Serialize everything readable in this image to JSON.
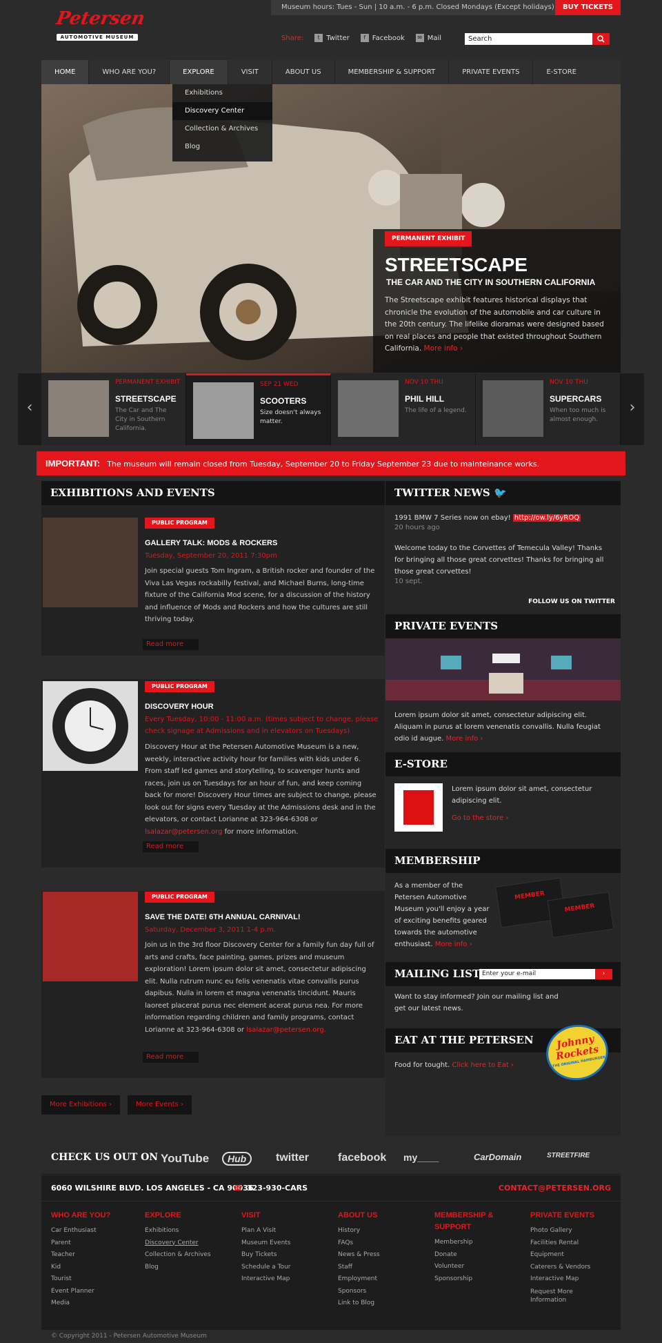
{
  "topbar": {
    "hours": "Museum hours: Tues - Sun | 10 a.m. - 6 p.m. Closed Mondays (Except holidays)",
    "buy": "BUY TICKETS"
  },
  "logo": {
    "name": "Petersen",
    "sub": "AUTOMOTIVE MUSEUM"
  },
  "share": {
    "label": "Share:",
    "twitter": "Twitter",
    "facebook": "Facebook",
    "mail": "Mail"
  },
  "search": {
    "placeholder": "Search"
  },
  "nav": [
    "HOME",
    "WHO ARE YOU?",
    "EXPLORE",
    "VISIT",
    "ABOUT US",
    "MEMBERSHIP & SUPPORT",
    "PRIVATE EVENTS",
    "E-STORE"
  ],
  "dropdown": [
    "Exhibitions",
    "Discovery Center",
    "Collection & Archives",
    "Blog"
  ],
  "hero": {
    "tag": "PERMANENT EXHIBIT",
    "title": "STREETSCAPE",
    "subtitle": "THE CAR AND THE CITY IN SOUTHERN CALIFORNIA",
    "body": "The Streetscape exhibit features historical displays that chronicle the evolution of the automobile and car culture in the 20th century. The lifelike dioramas were designed based on real places and people that existed throughout Southern California.",
    "more": "More info ›"
  },
  "slides": [
    {
      "date": "PERMANENT EXHIBIT",
      "title": "STREETSCAPE",
      "desc": "The Car and The City in Southern California."
    },
    {
      "date": "SEP 21 WED",
      "title": "SCOOTERS",
      "desc": "Size doesn't always matter."
    },
    {
      "date": "NOV 10 THU",
      "title": "PHIL HILL",
      "desc": "The life of a legend."
    },
    {
      "date": "NOV 10 THU",
      "title": "SUPERCARS",
      "desc": "When too much is almost enough."
    }
  ],
  "important": {
    "label": "IMPORTANT:",
    "text": "The museum will remain closed from Tuesday, September 20 to Friday September 23 due to mainteinance works."
  },
  "exhibitions": {
    "heading": "EXHIBITIONS AND EVENTS",
    "events": [
      {
        "tag": "PUBLIC PROGRAM",
        "title": "GALLERY TALK: MODS & ROCKERS",
        "date": "Tuesday, September 20, 2011 7:30pm",
        "body": "Join special guests Tom Ingram, a British rocker and founder of the Viva Las Vegas rockabilly festival, and Michael Burns, long-time fixture of the California Mod scene, for a discussion of the history and influence of Mods and Rockers and how the cultures are still thriving today.",
        "more": "Read more"
      },
      {
        "tag": "PUBLIC PROGRAM",
        "title": "DISCOVERY HOUR",
        "date": "Every Tuesday, 10:00 - 11:00 a.m. (times subject to change, please check signage at Admissions and in elevators on Tuesdays)",
        "body": "Discovery Hour at the Petersen Automotive Museum is a new, weekly, interactive activity hour for families with kids under 6. From staff led games and storytelling, to scavenger hunts and races, join us on Tuesdays for an hour of fun, and keep coming back for more! Discovery Hour times are subject to change, please look out for signs every Tuesday at the Admissions desk and in the elevators, or contact Lorianne at 323-964-6308 or",
        "email": "lsalazar@petersen.org",
        "tail": " for more information.",
        "more": "Read more"
      },
      {
        "tag": "PUBLIC PROGRAM",
        "title": "SAVE THE DATE! 6TH ANNUAL CARNIVAL!",
        "date": "Saturday, December 3, 2011 1-4 p.m.",
        "body": "Join us in the 3rd floor Discovery Center for a family fun day full of arts and crafts, face painting, games, prizes and museum exploration! Lorem ipsum dolor sit amet, consectetur adipiscing elit. Nulla rutrum nunc eu felis venenatis vitae convallis purus dapibus. Nulla in lorem et magna venenatis tincidunt. Mauris laoreet placerat purus nec element acerat purus nea. For more information regarding children and family programs, contact Lorianne at 323-964-6308 or",
        "email": "lsalazar@petersen.org.",
        "more": "Read more"
      }
    ],
    "more_exhibitions": "More Exhibitions ›",
    "more_events": "More Events ›"
  },
  "twitter": {
    "heading": "TWITTER NEWS",
    "t1": "1991 BMW 7 Series now on ebay!",
    "t1link": "http://ow.ly/6yROQ",
    "t1time": "20 hours ago",
    "t2": "Welcome today to the Corvettes of Temecula Valley! Thanks for bringing all those great corvettes! Thanks for bringing all those great corvettes!",
    "t2time": "10 sept.",
    "follow": "FOLLOW US ON TWITTER"
  },
  "private": {
    "heading": "PRIVATE EVENTS",
    "body": "Lorem ipsum dolor sit amet, consectetur adipiscing elit. Aliquam in purus at lorem venenatis convallis. Nulla feugiat odio id augue.",
    "more": "More info ›"
  },
  "estore": {
    "heading": "E-STORE",
    "body": "Lorem ipsum dolor sit amet, consectetur adipiscing elit.",
    "more": "Go to the store ›"
  },
  "membership": {
    "heading": "MEMBERSHIP",
    "body": "As a member of the Petersen Automotive Museum you'll enjoy a year of exciting benefits geared towards the automotive enthusiast.",
    "more": "More info ›",
    "card": "MEMBER"
  },
  "mailing": {
    "heading": "MAILING LIST",
    "placeholder": "Enter your e-mail",
    "body": "Want to stay informed? Join our mailing list and get our latest news."
  },
  "eat": {
    "heading": "EAT AT THE PETERSEN",
    "body": "Food for tought.",
    "link": "Click here to Eat ›",
    "logo": "Johnny Rockets",
    "logo_sub": "THE ORIGINAL HAMBURGER"
  },
  "checkout": {
    "label": "CHECK US OUT ON",
    "brands": [
      "YouTube",
      "Hub",
      "twitter",
      "facebook",
      "my____",
      "CarDomain",
      "STREETFIRE"
    ]
  },
  "address": {
    "addr": "6060 WILSHIRE BLVD. LOS ANGELES - CA 90036",
    "phone": "323-930-CARS",
    "contact": "CONTACT@PETERSEN.ORG"
  },
  "footer": [
    {
      "h": "WHO ARE YOU?",
      "links": [
        "Car Enthusiast",
        "Parent",
        "Teacher",
        "Kid",
        "Tourist",
        "Event Planner",
        "Media"
      ]
    },
    {
      "h": "EXPLORE",
      "links": [
        "Exhibitions",
        "Discovery Center",
        "Collection & Archives",
        "Blog"
      ]
    },
    {
      "h": "VISIT",
      "links": [
        "Plan A Visit",
        "Museum Events",
        "Buy Tickets",
        "Schedule a Tour",
        "Interactive Map"
      ]
    },
    {
      "h": "ABOUT US",
      "links": [
        "History",
        "FAQs",
        "News & Press",
        "Staff",
        "Employment",
        "Sponsors",
        "Link to Blog"
      ]
    },
    {
      "h": "MEMBERSHIP & SUPPORT",
      "links": [
        "Membership",
        "Donate",
        "Volunteer",
        "Sponsorship"
      ]
    },
    {
      "h": "PRIVATE EVENTS",
      "links": [
        "Photo Gallery",
        "Facilities Rental",
        "Equipment",
        "Caterers & Vendors",
        "Interactive Map",
        "Request More Information"
      ]
    }
  ],
  "copyright": "© Copyright 2011 - Petersen Automotive Museum",
  "colors": {
    "accent": "#e3161b",
    "bg": "#2b2b2b",
    "panel": "#141414"
  }
}
